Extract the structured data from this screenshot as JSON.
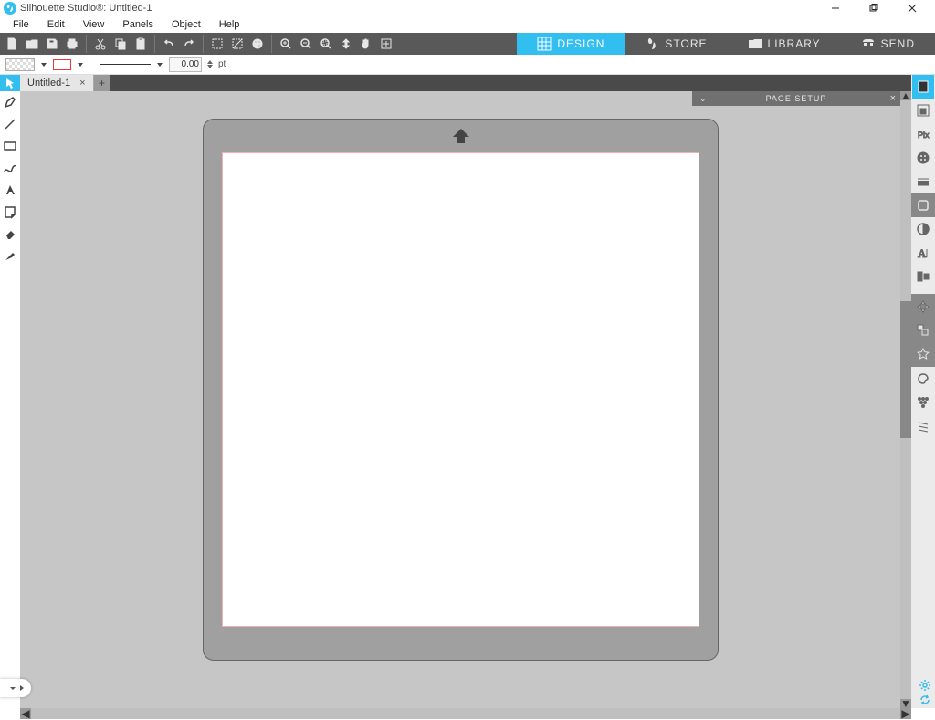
{
  "title": "Silhouette Studio®: Untitled-1",
  "menu": [
    "File",
    "Edit",
    "View",
    "Panels",
    "Object",
    "Help"
  ],
  "nav": [
    {
      "label": "DESIGN",
      "icon": "grid",
      "active": true
    },
    {
      "label": "STORE",
      "icon": "silhouette",
      "active": false
    },
    {
      "label": "LIBRARY",
      "icon": "folder",
      "active": false
    },
    {
      "label": "SEND",
      "icon": "phone",
      "active": false
    }
  ],
  "line_weight": "0.00",
  "line_unit": "pt",
  "doc_tab": "Untitled-1",
  "panel_title": "PAGE SETUP",
  "left_tools": [
    "select",
    "edit-points",
    "line",
    "rect",
    "text-a",
    "note",
    "eraser",
    "knife"
  ],
  "right_tools": [
    {
      "n": "page-setup",
      "active": true
    },
    {
      "n": "pixscan"
    },
    {
      "n": "image-effects"
    },
    {
      "n": "fill"
    },
    {
      "n": "line-style"
    },
    {
      "n": "trace",
      "dark": true
    },
    {
      "n": "contrast"
    },
    {
      "n": "text-style"
    },
    {
      "n": "align"
    },
    {
      "n": "transform"
    },
    {
      "n": "replicate"
    },
    {
      "n": "sticker"
    },
    {
      "n": "nesting"
    },
    {
      "n": "rhinestone"
    },
    {
      "n": "sketch"
    }
  ]
}
